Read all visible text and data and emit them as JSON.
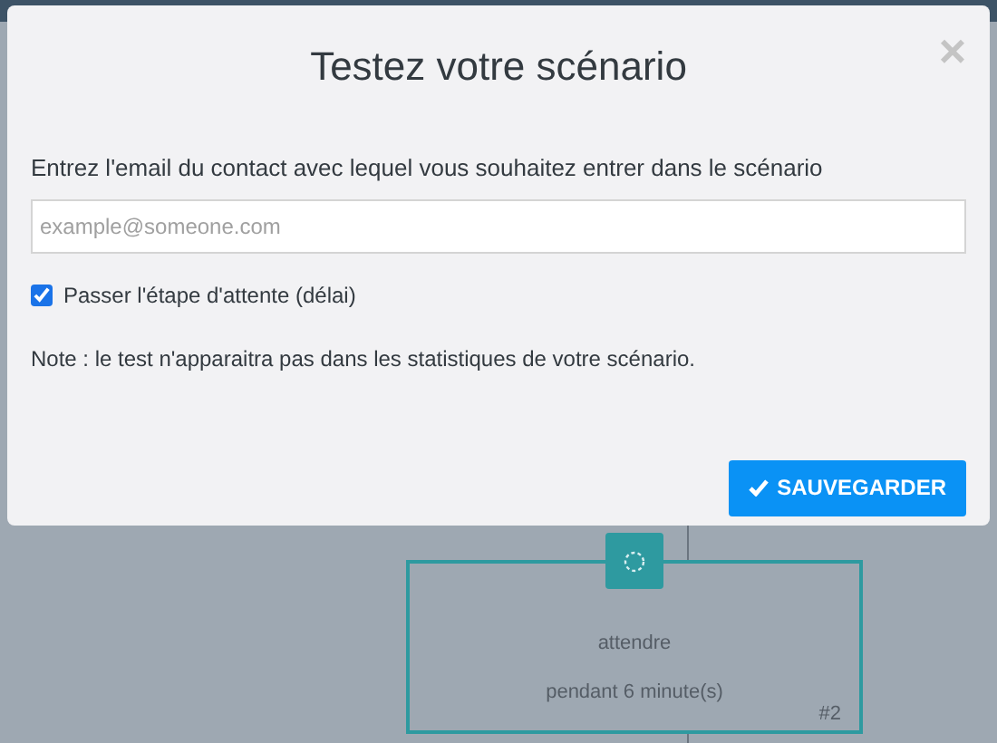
{
  "dialog": {
    "title": "Testez votre scénario",
    "close": "×",
    "email_label": "Entrez l'email du contact avec lequel vous souhaitez entrer dans le scénario",
    "email_field": {
      "placeholder": "example@someone.com"
    },
    "skip_wait": {
      "label": "Passer l'étape d'attente (délai)",
      "checked": true
    },
    "note": "Note : le test n'apparaitra pas dans les statistiques de votre scénario.",
    "save_button": "SAUVEGARDER"
  },
  "canvas": {
    "node": {
      "line_1": "attendre",
      "line_2": "pendant 6 minute(s)",
      "number": "#2"
    }
  }
}
